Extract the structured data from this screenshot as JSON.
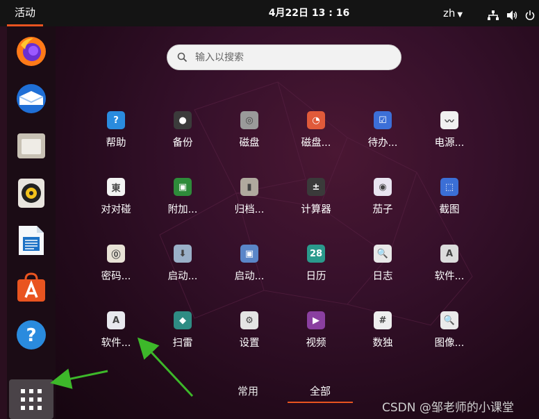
{
  "topbar": {
    "activities_label": "活动",
    "clock": "4月22日  13 : 16",
    "language": "zh",
    "network_icon": "network-wired-icon",
    "volume_icon": "volume-icon",
    "power_icon": "power-icon"
  },
  "dock": {
    "items": [
      {
        "name": "firefox",
        "icon": "firefox-icon"
      },
      {
        "name": "thunderbird",
        "icon": "thunderbird-icon"
      },
      {
        "name": "files",
        "icon": "folder-icon"
      },
      {
        "name": "rhythmbox",
        "icon": "speaker-icon"
      },
      {
        "name": "writer",
        "icon": "document-icon"
      },
      {
        "name": "software",
        "icon": "software-store-icon"
      },
      {
        "name": "help",
        "icon": "help-icon"
      }
    ],
    "show_apps_icon": "grid-dots-icon"
  },
  "search": {
    "placeholder": "输入以搜索"
  },
  "apps": [
    {
      "label": "帮助",
      "icon": "help-icon",
      "color": "#2a8bde",
      "glyph": "?"
    },
    {
      "label": "备份",
      "icon": "backup-icon",
      "color": "#3b3b3b",
      "glyph": "●"
    },
    {
      "label": "磁盘",
      "icon": "disk-icon",
      "color": "#9a9a9a",
      "glyph": "◎"
    },
    {
      "label": "磁盘...",
      "icon": "disk-usage-icon",
      "color": "#e05a3a",
      "glyph": "◔"
    },
    {
      "label": "待办...",
      "icon": "todo-icon",
      "color": "#3c6fd8",
      "glyph": "☑"
    },
    {
      "label": "电源...",
      "icon": "power-stats-icon",
      "color": "#f0f0f0",
      "glyph": "〰"
    },
    {
      "label": "对对碰",
      "icon": "mahjongg-icon",
      "color": "#f3f3f3",
      "glyph": "東"
    },
    {
      "label": "附加...",
      "icon": "chip-icon",
      "color": "#2e8b3a",
      "glyph": "▣"
    },
    {
      "label": "归档...",
      "icon": "archive-icon",
      "color": "#b0a99e",
      "glyph": "▮"
    },
    {
      "label": "计算器",
      "icon": "calculator-icon",
      "color": "#3a3a3a",
      "glyph": "±"
    },
    {
      "label": "茄子",
      "icon": "camera-icon",
      "color": "#e8e4f0",
      "glyph": "◉"
    },
    {
      "label": "截图",
      "icon": "screenshot-icon",
      "color": "#3b6fd6",
      "glyph": "⬚"
    },
    {
      "label": "密码...",
      "icon": "password-icon",
      "color": "#e8e2d6",
      "glyph": "⓪"
    },
    {
      "label": "启动...",
      "icon": "startup-disk-icon",
      "color": "#9ab0c8",
      "glyph": "⬇"
    },
    {
      "label": "启动...",
      "icon": "startup-apps-icon",
      "color": "#5a86c8",
      "glyph": "▣"
    },
    {
      "label": "日历",
      "icon": "calendar-icon",
      "color": "#2a9a8c",
      "glyph": "28"
    },
    {
      "label": "日志",
      "icon": "logs-icon",
      "color": "#e8e8e8",
      "glyph": "🔍"
    },
    {
      "label": "软件...",
      "icon": "software-properties-icon",
      "color": "#dcdcdc",
      "glyph": "A"
    },
    {
      "label": "软件...",
      "icon": "software-updater-icon",
      "color": "#e8e8ee",
      "glyph": "A"
    },
    {
      "label": "扫雷",
      "icon": "mines-icon",
      "color": "#2f8c84",
      "glyph": "◆"
    },
    {
      "label": "设置",
      "icon": "settings-icon",
      "color": "#e4e4e4",
      "glyph": "⚙"
    },
    {
      "label": "视频",
      "icon": "video-icon",
      "color": "#8a3fa0",
      "glyph": "▶"
    },
    {
      "label": "数独",
      "icon": "sudoku-icon",
      "color": "#eeeeee",
      "glyph": "#"
    },
    {
      "label": "图像...",
      "icon": "image-viewer-icon",
      "color": "#eaeaea",
      "glyph": "🔍"
    }
  ],
  "tabs": {
    "frequent": "常用",
    "all": "全部"
  },
  "watermark": "CSDN @邹老师的小课堂",
  "colors": {
    "accent": "#e95420",
    "annotation_arrow": "#3db82a"
  }
}
